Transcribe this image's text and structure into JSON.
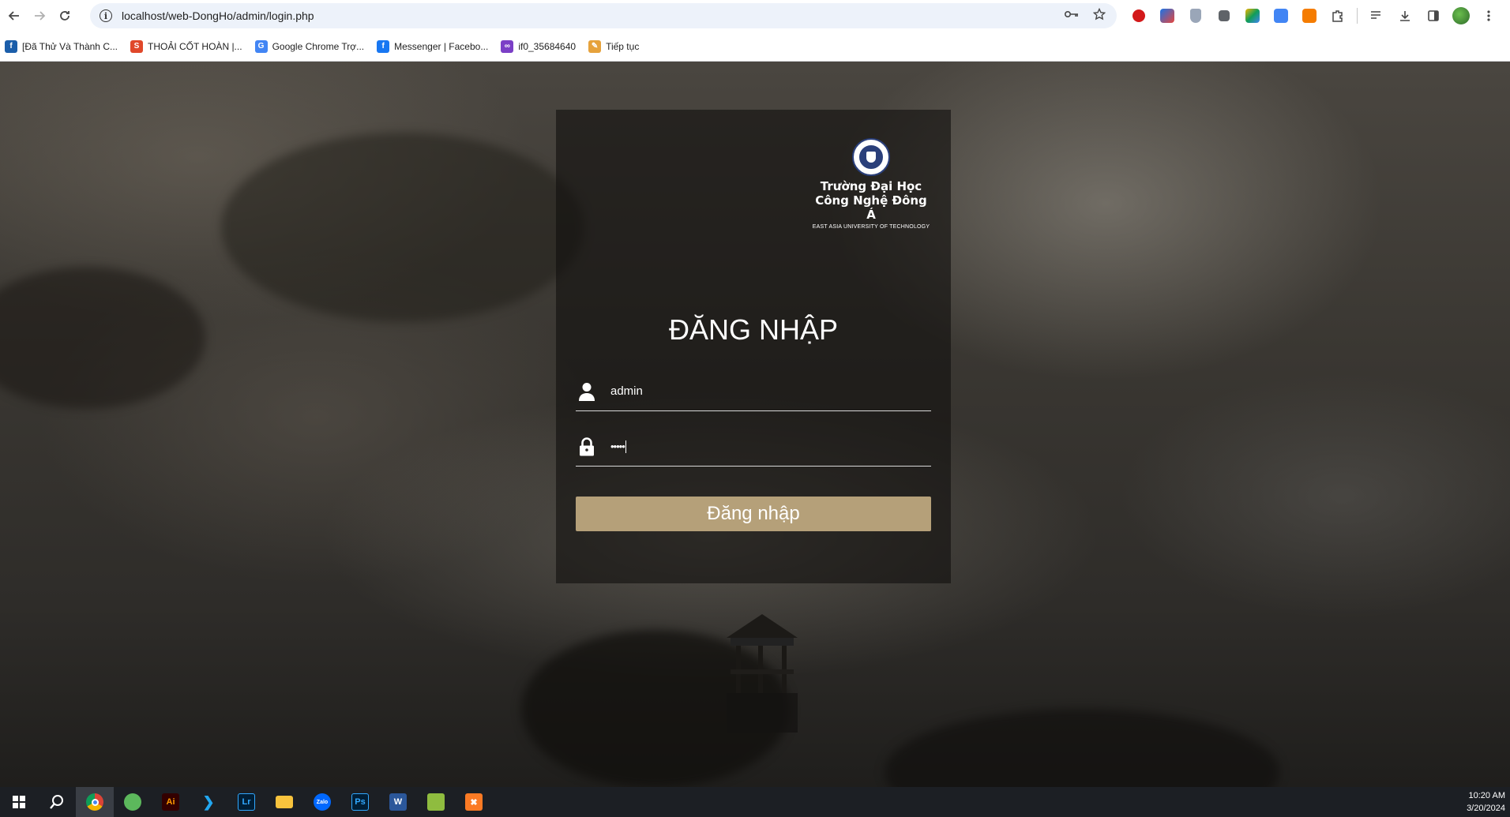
{
  "browser": {
    "url": "localhost/web-DongHo/admin/login.php",
    "nav": {
      "back_icon": "arrow-left-icon",
      "forward_icon": "arrow-right-icon",
      "reload_icon": "reload-icon"
    }
  },
  "bookmarks": [
    {
      "label": "[Đã Thử Và Thành C...",
      "icon": "f",
      "color": "#1b5eaa"
    },
    {
      "label": "THOẢI CỐT HOÀN |...",
      "icon": "S",
      "color": "#e0482a"
    },
    {
      "label": "Google Chrome Trợ...",
      "icon": "G",
      "color": "#4285f4"
    },
    {
      "label": "Messenger | Facebo...",
      "icon": "f",
      "color": "#1877f2"
    },
    {
      "label": "if0_35684640",
      "icon": "∞",
      "color": "#7b3fc6"
    },
    {
      "label": "Tiếp tục",
      "icon": "✎",
      "color": "#e6a23c"
    }
  ],
  "logo": {
    "line1": "Trường Đại Học",
    "line2": "Công Nghệ Đông Á",
    "line3": "EAST ASIA UNIVERSITY OF TECHNOLOGY"
  },
  "login": {
    "title": "ĐĂNG NHẬP",
    "username_value": "admin",
    "password_value": "•••••",
    "submit_label": "Đăng nhập"
  },
  "taskbar": {
    "time": "10:20 AM",
    "date": "3/20/2024"
  }
}
